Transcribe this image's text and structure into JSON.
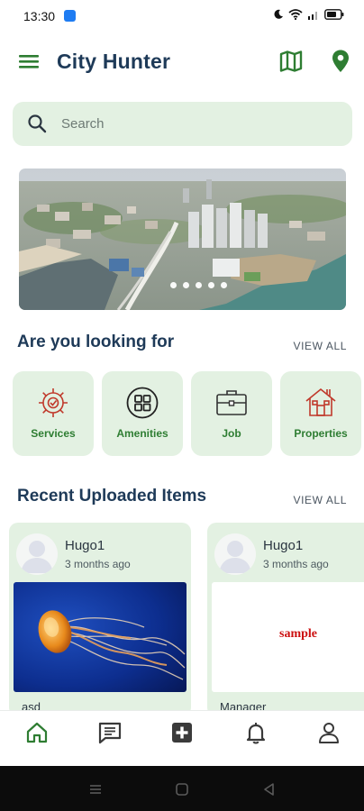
{
  "status_bar": {
    "time": "13:30"
  },
  "app_bar": {
    "title": "City Hunter"
  },
  "search": {
    "placeholder": "Search"
  },
  "categories_section": {
    "title": "Are you looking for",
    "view_all": "VIEW ALL",
    "items": [
      {
        "label": "Services",
        "icon": "services-gear-icon"
      },
      {
        "label": "Amenities",
        "icon": "amenities-grid-icon"
      },
      {
        "label": "Job",
        "icon": "briefcase-icon"
      },
      {
        "label": "Properties",
        "icon": "house-icon"
      }
    ]
  },
  "recent_section": {
    "title": "Recent Uploaded Items",
    "view_all": "VIEW ALL",
    "items": [
      {
        "user": "Hugo1",
        "time": "3 months ago",
        "title": "asd",
        "image": "jellyfish"
      },
      {
        "user": "Hugo1",
        "time": "3 months ago",
        "title": "Manager",
        "image_text": "sample"
      }
    ]
  },
  "bottom_nav": [
    "home-icon",
    "chat-icon",
    "add-icon",
    "bell-icon",
    "profile-icon"
  ],
  "colors": {
    "primary": "#2e7d32",
    "title": "#1e3a58",
    "card_bg": "#e3f1e2"
  }
}
